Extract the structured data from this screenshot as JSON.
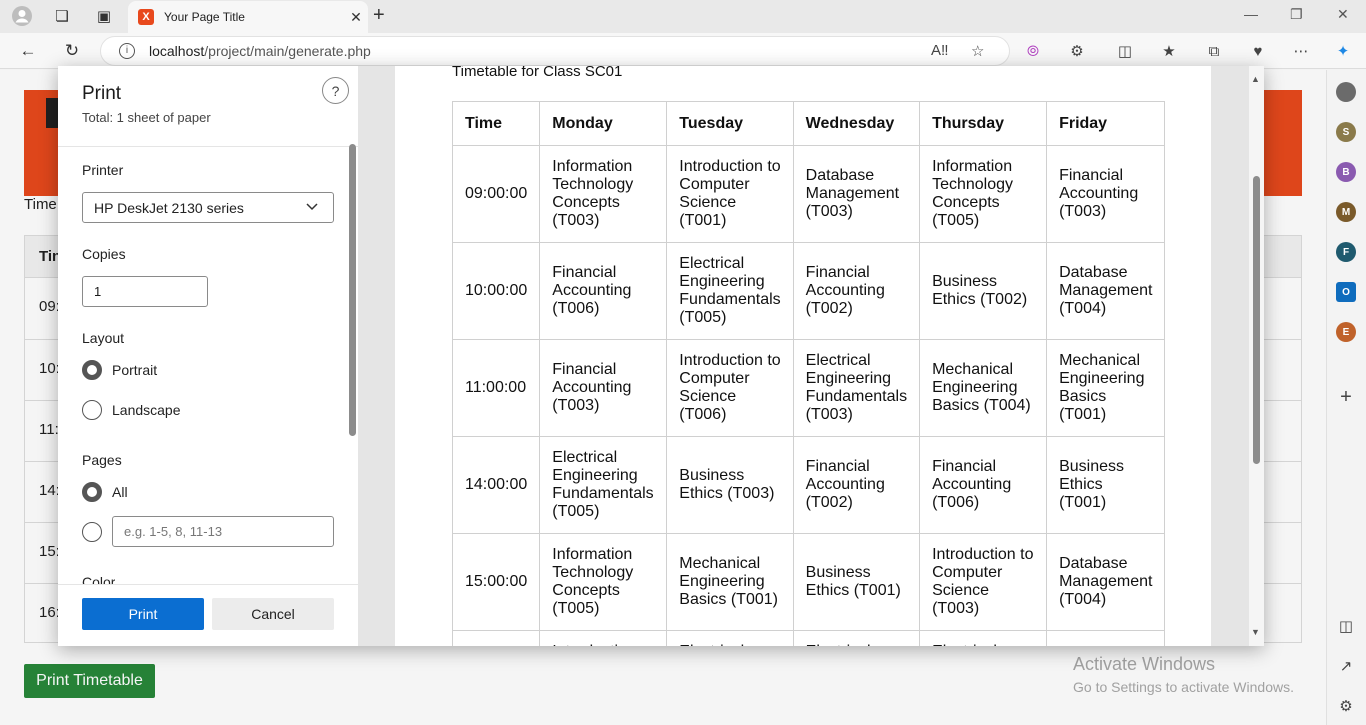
{
  "browser": {
    "tab_title": "Your Page Title",
    "tab_favicon": "X",
    "url_host": "localhost",
    "url_path": "/project/main/generate.php"
  },
  "sidebar": {
    "avatars": [
      {
        "letter": "",
        "color": "#6b6b6b"
      },
      {
        "letter": "S",
        "color": "#8a7a4a"
      },
      {
        "letter": "B",
        "color": "#8a5ab0"
      },
      {
        "letter": "M",
        "color": "#7a5a2a"
      },
      {
        "letter": "F",
        "color": "#1f5a6e"
      },
      {
        "letter": "O",
        "color": "#0f6cbd"
      },
      {
        "letter": "E",
        "color": "#c0622a"
      }
    ]
  },
  "page": {
    "subtitle": "Time",
    "table_header": "Tin",
    "row_times": [
      "09:",
      "10:",
      "11:",
      "14:",
      "15:",
      "16:"
    ],
    "print_button": "Print Timetable",
    "activate_title": "Activate Windows",
    "activate_sub": "Go to Settings to activate Windows."
  },
  "print_dialog": {
    "title": "Print",
    "total": "Total: 1 sheet of paper",
    "help": "?",
    "printer_label": "Printer",
    "printer_value": "HP DeskJet 2130 series",
    "copies_label": "Copies",
    "copies_value": "1",
    "layout_label": "Layout",
    "layout_portrait": "Portrait",
    "layout_landscape": "Landscape",
    "pages_label": "Pages",
    "pages_all": "All",
    "pages_placeholder": "e.g. 1-5, 8, 11-13",
    "color_label": "Color",
    "print_button": "Print",
    "cancel_button": "Cancel"
  },
  "preview": {
    "title": "Timetable for Class SC01",
    "headers": [
      "Time",
      "Monday",
      "Tuesday",
      "Wednesday",
      "Thursday",
      "Friday"
    ],
    "rows": [
      [
        "09:00:00",
        "Information Technology Concepts (T003)",
        "Introduction to Computer Science (T001)",
        "Database Management (T003)",
        "Information Technology Concepts (T005)",
        "Financial Accounting (T003)"
      ],
      [
        "10:00:00",
        "Financial Accounting (T006)",
        "Electrical Engineering Fundamentals (T005)",
        "Financial Accounting (T002)",
        "Business Ethics (T002)",
        "Database Management (T004)"
      ],
      [
        "11:00:00",
        "Financial Accounting (T003)",
        "Introduction to Computer Science (T006)",
        "Electrical Engineering Fundamentals (T003)",
        "Mechanical Engineering Basics (T004)",
        "Mechanical Engineering Basics (T001)"
      ],
      [
        "14:00:00",
        "Electrical Engineering Fundamentals (T005)",
        "Business Ethics (T003)",
        "Financial Accounting (T002)",
        "Financial Accounting (T006)",
        "Business Ethics (T001)"
      ],
      [
        "15:00:00",
        "Information Technology Concepts (T005)",
        "Mechanical Engineering Basics (T001)",
        "Business Ethics (T001)",
        "Introduction to Computer Science (T003)",
        "Database Management (T004)"
      ],
      [
        "",
        "Introduction",
        "Electrical",
        "Electrical",
        "Electrical",
        ""
      ]
    ]
  }
}
